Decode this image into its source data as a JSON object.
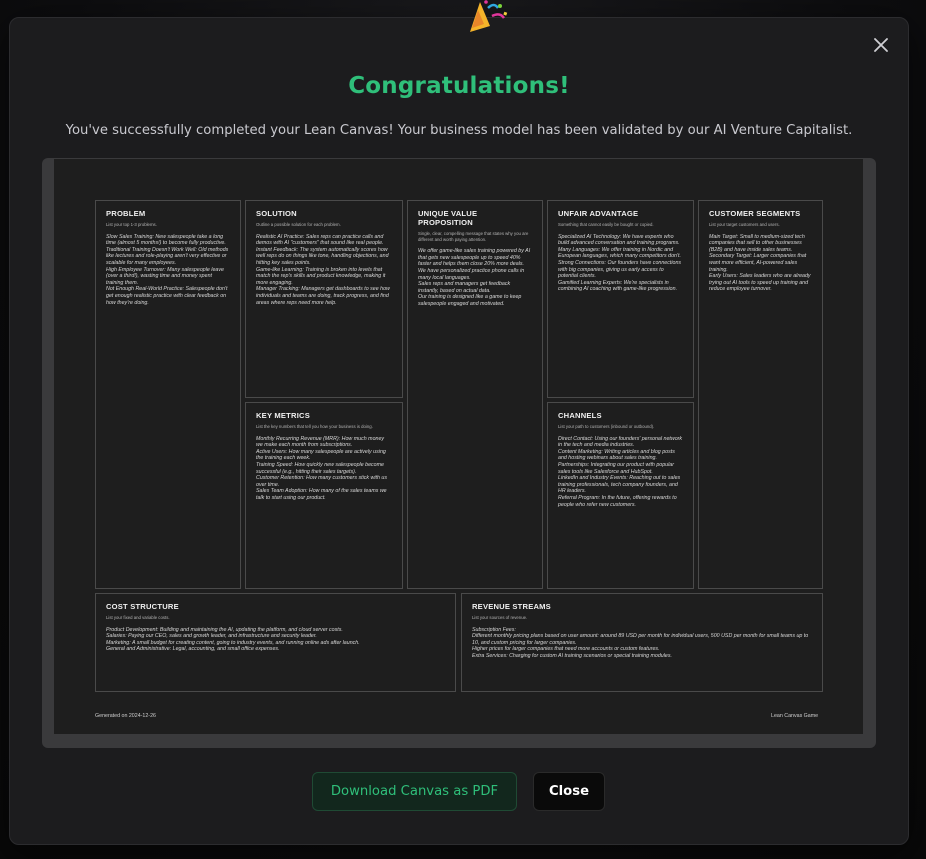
{
  "modal": {
    "title": "Congratulations!",
    "subtitle": "You've successfully completed your Lean Canvas! Your business model has been validated by our AI Venture Capitalist.",
    "close_icon": "close-icon",
    "celebration_icon": "party-popper-icon"
  },
  "canvas": {
    "problem": {
      "title": "PROBLEM",
      "hint": "List your top 1-3 problems.",
      "body": "Slow Sales Training: New salespeople take a long time (almost 5 months!) to become fully productive.\nTraditional Training Doesn't Work Well: Old methods like lectures and role-playing aren't very effective or scalable for many employees.\nHigh Employee Turnover: Many salespeople leave (over a third!), wasting time and money spent training them.\nNot Enough Real-World Practice: Salespeople don't get enough realistic practice with clear feedback on how they're doing."
    },
    "solution": {
      "title": "SOLUTION",
      "hint": "Outline a possible solution for each problem.",
      "body": "Realistic AI Practice: Sales reps can practice calls and demos with AI \"customers\" that sound like real people.\nInstant Feedback: The system automatically scores how well reps do on things like tone, handling objections, and hitting key sales points.\nGame-like Learning: Training is broken into levels that match the rep's skills and product knowledge, making it more engaging.\nManager Tracking: Managers get dashboards to see how individuals and teams are doing, track progress, and find areas where reps need more help."
    },
    "uvp": {
      "title": "UNIQUE VALUE PROPOSITION",
      "hint": "Single, clear, compelling message that states why you are different and worth paying attention.",
      "body": "We offer game-like sales training powered by AI that gets new salespeople up to speed 40% faster and helps them close 20% more deals.\nWe have personalized practice phone calls in many local languages.\nSales reps and managers get feedback instantly, based on actual data.\nOur training is designed like a game to keep salespeople engaged and motivated."
    },
    "unfair_advantage": {
      "title": "UNFAIR ADVANTAGE",
      "hint": "Something that cannot easily be bought or copied.",
      "body": "Specialized AI Technology: We have experts who build advanced conversation and training programs.\nMany Languages: We offer training in Nordic and European languages, which many competitors don't.\nStrong Connections: Our founders have connections with big companies, giving us early access to potential clients.\nGamified Learning Experts: We're specialists in combining AI coaching with game-like progression."
    },
    "customer_segments": {
      "title": "CUSTOMER SEGMENTS",
      "hint": "List your target customers and users.",
      "body": "Main Target: Small to medium-sized tech companies that sell to other businesses (B2B) and have inside sales teams.\nSecondary Target: Larger companies that want more efficient, AI-powered sales training.\nEarly Users: Sales leaders who are already trying out AI tools to speed up training and reduce employee turnover."
    },
    "key_metrics": {
      "title": "KEY METRICS",
      "hint": "List the key numbers that tell you how your business is doing.",
      "body": "Monthly Recurring Revenue (MRR): How much money we make each month from subscriptions.\nActive Users: How many salespeople are actively using the training each week.\nTraining Speed: How quickly new salespeople become successful (e.g., hitting their sales targets).\nCustomer Retention: How many customers stick with us over time.\nSales Team Adoption: How many of the sales teams we talk to start using our product."
    },
    "channels": {
      "title": "CHANNELS",
      "hint": "List your path to customers (inbound or outbound).",
      "body": "Direct Contact: Using our founders' personal network in the tech and media industries.\nContent Marketing: Writing articles and blog posts and hosting webinars about sales training.\nPartnerships: Integrating our product with popular sales tools like Salesforce and HubSpot.\nLinkedIn and Industry Events: Reaching out to sales training professionals, tech company founders, and HR leaders.\nReferral Program: In the future, offering rewards to people who refer new customers."
    },
    "cost_structure": {
      "title": "COST STRUCTURE",
      "hint": "List your fixed and variable costs.",
      "body": "Product Development: Building and maintaining the AI, updating the platform, and cloud server costs.\nSalaries: Paying our CEO, sales and growth leader, and infrastructure and security leader.\nMarketing: A small budget for creating content, going to industry events, and running online ads after launch.\nGeneral and Administrative: Legal, accounting, and small office expenses."
    },
    "revenue_streams": {
      "title": "REVENUE STREAMS",
      "hint": "List your sources of revenue.",
      "body": "Subscription Fees:\nDifferent monthly pricing plans based on user amount: around 89 USD per month for individual users, 500 USD per month for small teams up to 10, and custom pricing for larger companies.\nHigher prices for larger companies that need more accounts or custom features.\nExtra Services: Charging for custom AI training scenarios or special training modules."
    },
    "footer_left": "Generated on 2024-12-26",
    "footer_right": "Lean Canvas Game"
  },
  "actions": {
    "download_label": "Download Canvas as PDF",
    "close_label": "Close"
  },
  "colors": {
    "accent": "#2fbf7a",
    "modal_bg": "#1c1c1e",
    "canvas_bg": "#1e1e1e"
  }
}
